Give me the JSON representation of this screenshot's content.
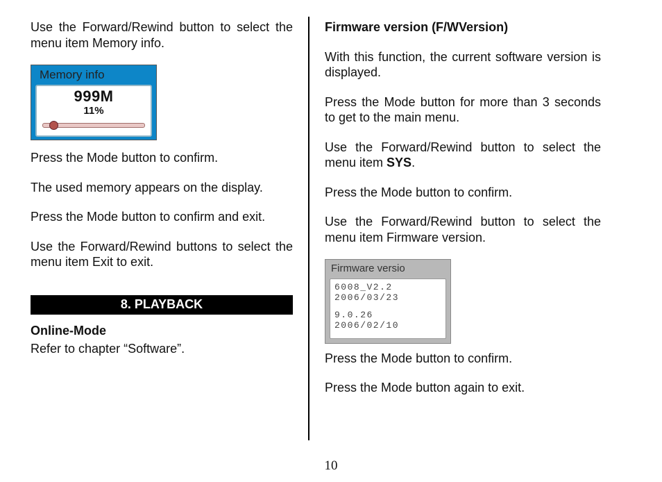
{
  "left": {
    "p1": "Use the Forward/Rewind button to select the menu item Memory info.",
    "memory_screen": {
      "title": "Memory info",
      "value": "999M",
      "percent": "11%"
    },
    "p2": "Press the Mode button to confirm.",
    "p3": "The used memory appears on the display.",
    "p4": "Press the Mode button to confirm and exit.",
    "p5": "Use the Forward/Rewind buttons to select the menu item Exit to exit.",
    "section_bar": "8. PLAYBACK",
    "online_heading": "Online-Mode",
    "online_text": "Refer to chapter “Software”."
  },
  "right": {
    "h1": "Firmware version (F/WVersion)",
    "p1": "With this function, the current software version is displayed.",
    "p2": "Press the Mode button for more than 3 seconds to get to the  main menu.",
    "p3a": "Use the Forward/Rewind button to select the menu item ",
    "p3b_bold": "SYS",
    "p3c": ".",
    "p4": "Press the Mode button to confirm.",
    "p5": "Use the Forward/Rewind button to select the menu item Firmware version.",
    "fw_screen": {
      "title": "Firmware versio",
      "line1": "6008_V2.2",
      "line2": "2006/03/23",
      "line3": "9.0.26",
      "line4": "2006/02/10"
    },
    "p6": "Press the Mode button to confirm.",
    "p7": "Press the Mode button again to exit."
  },
  "page_number": "10"
}
